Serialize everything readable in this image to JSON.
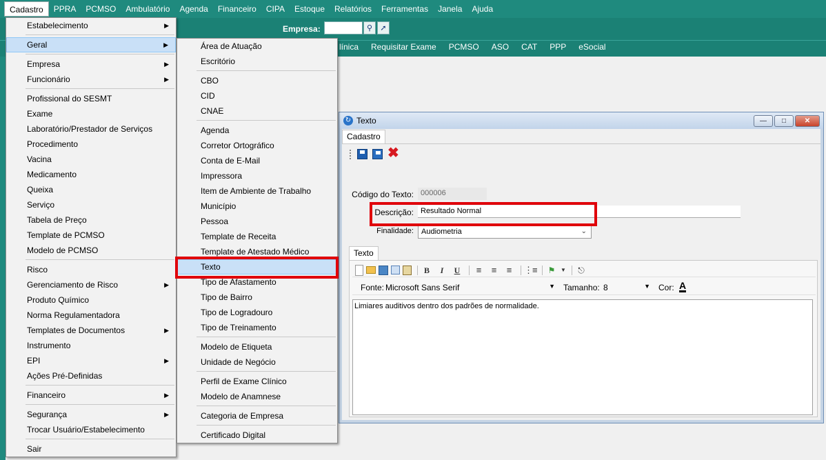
{
  "menubar": {
    "items": [
      "Cadastro",
      "PPRA",
      "PCMSO",
      "Ambulatório",
      "Agenda",
      "Financeiro",
      "CIPA",
      "Estoque",
      "Relatórios",
      "Ferramentas",
      "Janela",
      "Ajuda"
    ]
  },
  "toolbar": {
    "empresa_label": "Empresa:",
    "empresa_value": "",
    "quick_links": [
      "línica",
      "Requisitar Exame",
      "PCMSO",
      "ASO",
      "CAT",
      "PPP",
      "eSocial"
    ]
  },
  "menu_cadastro": {
    "items": [
      {
        "label": "Estabelecimento",
        "submenu": true
      },
      {
        "label": "Geral",
        "submenu": true,
        "highlighted": true
      },
      {
        "label": "Empresa",
        "submenu": true
      },
      {
        "label": "Funcionário",
        "submenu": true
      },
      {
        "label": "Profissional do SESMT"
      },
      {
        "label": "Exame"
      },
      {
        "label": "Laboratório/Prestador de Serviços"
      },
      {
        "label": "Procedimento"
      },
      {
        "label": "Vacina"
      },
      {
        "label": "Medicamento"
      },
      {
        "label": "Queixa"
      },
      {
        "label": "Serviço"
      },
      {
        "label": "Tabela de Preço"
      },
      {
        "label": "Template de PCMSO"
      },
      {
        "label": "Modelo de PCMSO"
      },
      {
        "label": "Risco"
      },
      {
        "label": "Gerenciamento de Risco",
        "submenu": true
      },
      {
        "label": "Produto Químico"
      },
      {
        "label": "Norma Regulamentadora"
      },
      {
        "label": "Templates de Documentos",
        "submenu": true
      },
      {
        "label": "Instrumento"
      },
      {
        "label": "EPI",
        "submenu": true
      },
      {
        "label": "Ações Pré-Definidas"
      },
      {
        "label": "Financeiro",
        "submenu": true
      },
      {
        "label": "Segurança",
        "submenu": true
      },
      {
        "label": "Trocar Usuário/Estabelecimento"
      },
      {
        "label": "Sair"
      }
    ]
  },
  "menu_geral": {
    "items": [
      {
        "label": "Área de Atuação"
      },
      {
        "label": "Escritório"
      },
      {
        "label": "CBO"
      },
      {
        "label": "CID"
      },
      {
        "label": "CNAE"
      },
      {
        "label": "Agenda"
      },
      {
        "label": "Corretor Ortográfico"
      },
      {
        "label": "Conta de E-Mail"
      },
      {
        "label": "Impressora"
      },
      {
        "label": "Item de Ambiente de Trabalho"
      },
      {
        "label": "Município"
      },
      {
        "label": "Pessoa"
      },
      {
        "label": "Template de Receita"
      },
      {
        "label": "Template de Atestado Médico"
      },
      {
        "label": "Texto",
        "highlighted": true
      },
      {
        "label": "Tipo de Afastamento"
      },
      {
        "label": "Tipo de Bairro"
      },
      {
        "label": "Tipo de Logradouro"
      },
      {
        "label": "Tipo de Treinamento"
      },
      {
        "label": "Modelo de Etiqueta"
      },
      {
        "label": "Unidade de Negócio"
      },
      {
        "label": "Perfil de Exame Clínico"
      },
      {
        "label": "Modelo de Anamnese"
      },
      {
        "label": "Categoria de Empresa"
      },
      {
        "label": "Certificado Digital"
      }
    ]
  },
  "window": {
    "title": "Texto",
    "tab": "Cadastro",
    "codigo_label": "Código do Texto:",
    "codigo_value": "000006",
    "descricao_label": "Descrição:",
    "descricao_value": "Resultado Normal",
    "finalidade_label": "Finalidade:",
    "finalidade_value": "Audiometria",
    "texto_tab": "Texto",
    "editor": {
      "fonte_label": "Fonte:",
      "fonte_value": "Microsoft Sans Serif",
      "tamanho_label": "Tamanho:",
      "tamanho_value": "8",
      "cor_label": "Cor:",
      "cor_icon": "A",
      "content": "Limiares auditivos dentro dos padrões de normalidade."
    }
  },
  "colors": {
    "teal": "#1f8a7e",
    "highlight_red": "#e0000a",
    "menu_highlight": "#c9e0f7"
  }
}
